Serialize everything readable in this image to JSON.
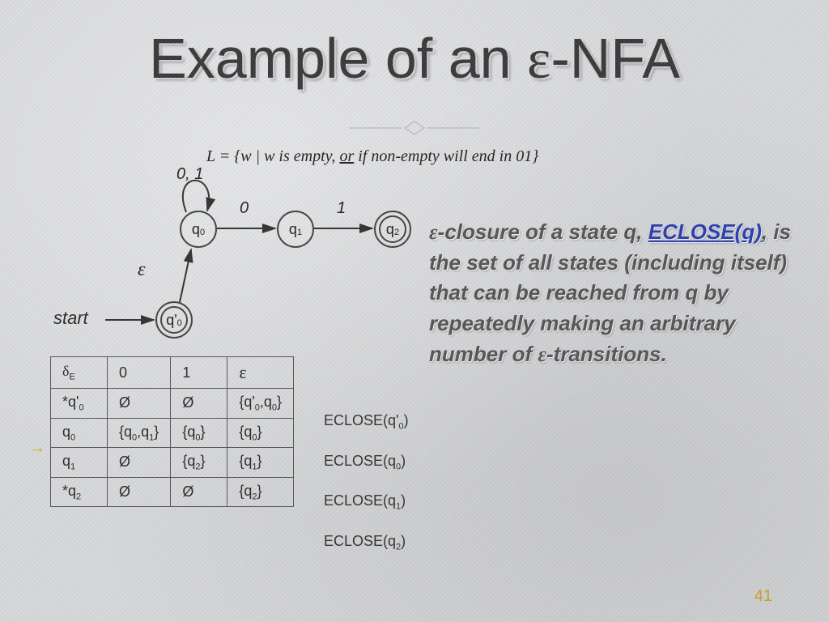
{
  "title_prefix": "Example of an ",
  "title_eps": "ε",
  "title_suffix": "-NFA",
  "language_prefix": "L = {w | w is empty, ",
  "language_or": "or",
  "language_suffix": " if non-empty will end in 01}",
  "diagram": {
    "loop_label": "0, 1",
    "edge_q0_q1": "0",
    "edge_q1_q2": "1",
    "epsilon_label": "ε",
    "start_label": "start",
    "states": {
      "q0_sym": "q",
      "q0_sub": "0",
      "q1_sym": "q",
      "q1_sub": "1",
      "q2_sym": "q",
      "q2_sub": "2",
      "qp0_sym": "q'",
      "qp0_sub": "0"
    }
  },
  "table": {
    "header": {
      "c0": "δ",
      "c0sub": "E",
      "c1": "0",
      "c2": "1",
      "c3": "ε"
    },
    "rows": [
      {
        "c0pre": "*",
        "c0": "q'",
        "c0sub": "0",
        "c1": "Ø",
        "c2": "Ø",
        "c3": "{q'",
        "c3sub1": "0",
        "c3mid": ",q",
        "c3sub2": "0",
        "c3suf": "}"
      },
      {
        "c0pre": "",
        "c0": "q",
        "c0sub": "0",
        "c1": "{q",
        "c1sub1": "0",
        "c1mid": ",q",
        "c1sub2": "1",
        "c1suf": "}",
        "c2": "{q",
        "c2sub": "0",
        "c2suf": "}",
        "c3": "{q",
        "c3sub1": "0",
        "c3mid": "",
        "c3sub2": "",
        "c3suf": "}"
      },
      {
        "c0pre": "",
        "c0": "q",
        "c0sub": "1",
        "c1": "Ø",
        "c2": "{q",
        "c2sub": "2",
        "c2suf": "}",
        "c3": "{q",
        "c3sub1": "1",
        "c3mid": "",
        "c3sub2": "",
        "c3suf": "}"
      },
      {
        "c0pre": "*",
        "c0": "q",
        "c0sub": "2",
        "c1": "Ø",
        "c2": "Ø",
        "c3": "{q",
        "c3sub1": "2",
        "c3mid": "",
        "c3sub2": "",
        "c3suf": "}"
      }
    ]
  },
  "annotations": [
    {
      "text": "ECLOSE(q'",
      "sub": "0",
      "suf": ")"
    },
    {
      "text": "ECLOSE(q",
      "sub": "0",
      "suf": ")"
    },
    {
      "text": "ECLOSE(q",
      "sub": "1",
      "suf": ")"
    },
    {
      "text": "ECLOSE(q",
      "sub": "2",
      "suf": ")"
    }
  ],
  "definition": {
    "p1a": "ε",
    "p1b": "-closure of a state q, ",
    "eclose": "ECLOSE(q)",
    "p2": ", is the set of all states (including itself) that can be reached from q by repeatedly making an arbitrary number of ",
    "p3a": "ε",
    "p3b": "-transitions."
  },
  "page_number": "41"
}
